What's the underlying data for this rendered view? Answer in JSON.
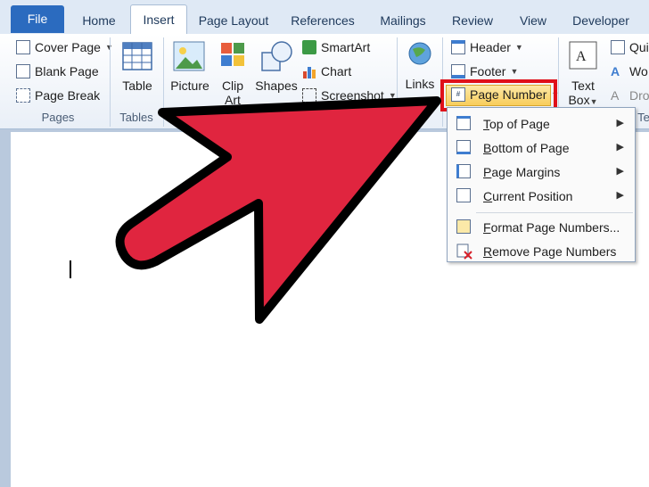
{
  "tabs": [
    "File",
    "Home",
    "Insert",
    "Page Layout",
    "References",
    "Mailings",
    "Review",
    "View",
    "Developer"
  ],
  "ribbon": {
    "pages": {
      "cover": "Cover Page",
      "blank": "Blank Page",
      "break": "Page Break",
      "group": "Pages"
    },
    "tables": {
      "table": "Table",
      "group": "Tables"
    },
    "illustrations": {
      "picture": "Picture",
      "clip1": "Clip",
      "clip2": "Art",
      "shapes": "Shapes",
      "smartart": "SmartArt",
      "chart": "Chart",
      "screenshot": "Screenshot"
    },
    "links": {
      "label": "Links"
    },
    "header_footer": {
      "header": "Header",
      "footer": "Footer",
      "page_number": "Page Number"
    },
    "text": {
      "textbox1": "Text",
      "textbox2": "Box",
      "quick": "Qui",
      "wordart": "Wo",
      "dropcap": "Dro",
      "group_partial": "Te"
    }
  },
  "menu": {
    "items": [
      {
        "label": "Top of Page",
        "underline": "T",
        "submenu": true
      },
      {
        "label": "Bottom of Page",
        "underline": "B",
        "submenu": true
      },
      {
        "label": "Page Margins",
        "underline": "P",
        "submenu": true
      },
      {
        "label": "Current Position",
        "underline": "C",
        "submenu": true
      },
      {
        "label": "Format Page Numbers...",
        "underline": "F",
        "submenu": false
      },
      {
        "label": "Remove Page Numbers",
        "underline": "R",
        "submenu": false
      }
    ]
  },
  "colors": {
    "highlight": "#e0101a",
    "arrow": "#e0253f",
    "file_tab": "#2b6bbf"
  }
}
